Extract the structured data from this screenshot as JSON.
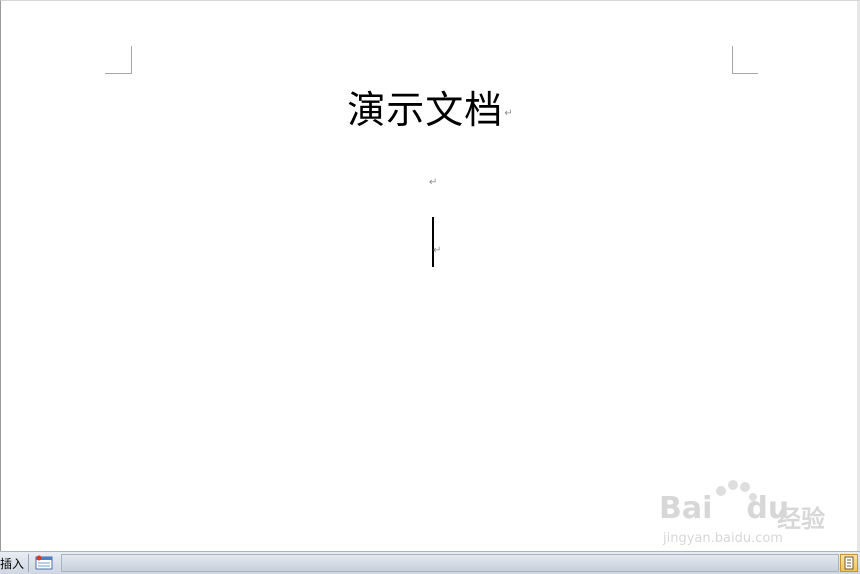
{
  "document": {
    "title": "演示文档",
    "paragraph_mark": "↵"
  },
  "status_bar": {
    "mode_label": "插入"
  },
  "watermark": {
    "brand": "Bai",
    "brand_suffix": "du",
    "product": "经验",
    "url": "jingyan.baidu.com"
  },
  "icons": {
    "macro": "macro-record-icon",
    "view": "print-layout-view-icon"
  },
  "colors": {
    "status_bar": "#cfd7e2",
    "view_button": "#f2c35a",
    "watermark": "#b8b8b8"
  }
}
